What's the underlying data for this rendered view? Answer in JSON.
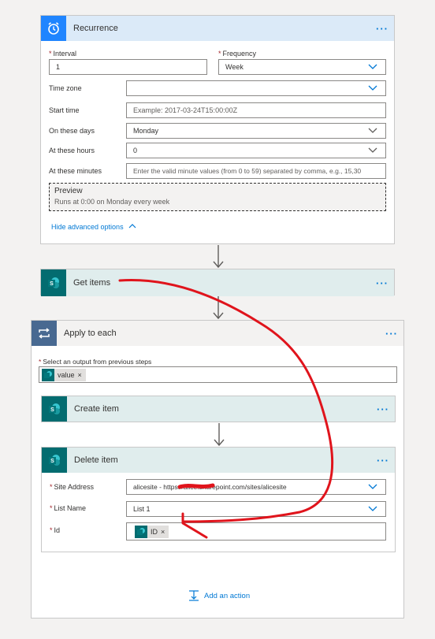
{
  "recurrence": {
    "title": "Recurrence",
    "more": "···",
    "interval_label": "Interval",
    "interval_value": "1",
    "frequency_label": "Frequency",
    "frequency_value": "Week",
    "timezone_label": "Time zone",
    "timezone_value": "",
    "starttime_label": "Start time",
    "starttime_placeholder": "Example: 2017-03-24T15:00:00Z",
    "days_label": "On these days",
    "days_value": "Monday",
    "hours_label": "At these hours",
    "hours_value": "0",
    "minutes_label": "At these minutes",
    "minutes_placeholder": "Enter the valid minute values (from 0 to 59) separated by comma, e.g., 15,30",
    "preview_title": "Preview",
    "preview_text": "Runs at 0:00 on Monday every week",
    "advanced_link": "Hide advanced options"
  },
  "get_items": {
    "title": "Get items",
    "more": "···"
  },
  "apply_each": {
    "title": "Apply to each",
    "more": "···",
    "select_label": "Select an output from previous steps",
    "token_value": "value"
  },
  "create_item": {
    "title": "Create item",
    "more": "···"
  },
  "delete_item": {
    "title": "Delete item",
    "more": "···",
    "site_label": "Site Address",
    "site_value": "alicesite - https://alice.sharepoint.com/sites/alicesite",
    "list_label": "List Name",
    "list_value": "List 1",
    "id_label": "Id",
    "id_token": "ID"
  },
  "add_action": "Add an action",
  "colors": {
    "recurrence_header": "#dbeaf8",
    "recurrence_icon": "#1f85ff",
    "sharepoint_header": "#e0eded",
    "sharepoint_icon": "#036c70",
    "apply_icon": "#486991",
    "annotation": "#e0141c",
    "link": "#0078d4"
  },
  "icons": {
    "recurrence": "alarm-clock-icon",
    "sharepoint": "sharepoint-icon",
    "apply": "loop-icon",
    "add_action": "add-action-icon"
  }
}
